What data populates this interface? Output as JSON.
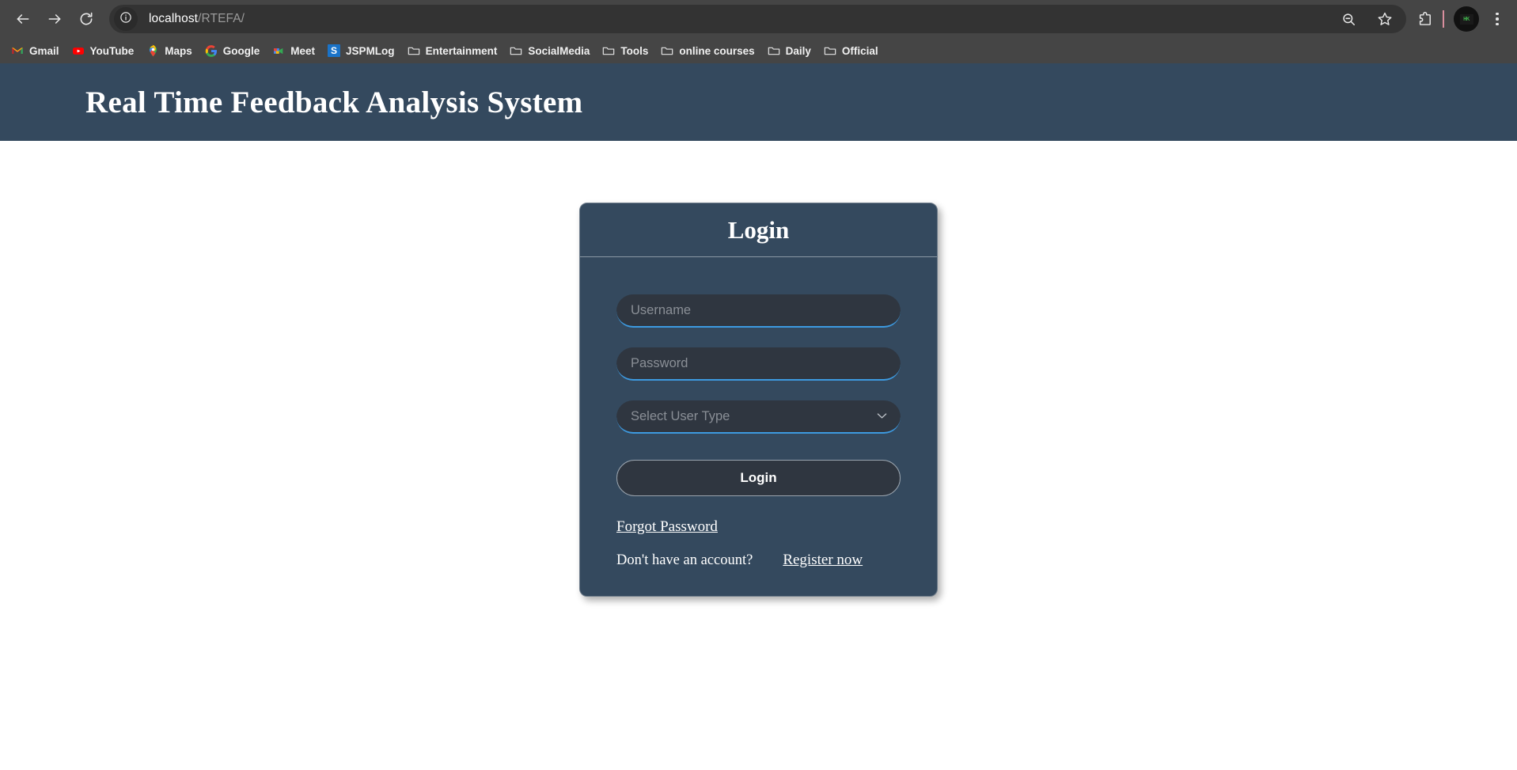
{
  "browser": {
    "back_icon": "back-arrow-icon",
    "forward_icon": "forward-arrow-icon",
    "reload_icon": "reload-icon",
    "site_info_icon": "info-circle-icon",
    "url_host": "localhost",
    "url_path": "/RTEFA/",
    "url_full": "localhost/RTEFA/",
    "zoom_icon": "search-zoom-icon",
    "bookmark_star_icon": "star-icon",
    "extensions_icon": "extensions-puzzle-icon",
    "avatar_label": "HK",
    "menu_icon": "three-dot-menu-icon",
    "bookmarks": [
      {
        "label": "Gmail",
        "icon": "gmail-icon"
      },
      {
        "label": "YouTube",
        "icon": "youtube-icon"
      },
      {
        "label": "Maps",
        "icon": "maps-pin-icon"
      },
      {
        "label": "Google",
        "icon": "google-g-icon"
      },
      {
        "label": "Meet",
        "icon": "google-meet-icon"
      },
      {
        "label": "JSPMLog",
        "icon": "jspmlog-icon"
      },
      {
        "label": "Entertainment",
        "icon": "folder-icon"
      },
      {
        "label": "SocialMedia",
        "icon": "folder-icon"
      },
      {
        "label": "Tools",
        "icon": "folder-icon"
      },
      {
        "label": "online courses",
        "icon": "folder-icon"
      },
      {
        "label": "Daily",
        "icon": "folder-icon"
      },
      {
        "label": "Official",
        "icon": "folder-icon"
      }
    ]
  },
  "app": {
    "header_title": "Real Time Feedback Analysis System",
    "header_bg": "#34495e"
  },
  "login": {
    "card_title": "Login",
    "username_placeholder": "Username",
    "username_value": "",
    "password_placeholder": "Password",
    "password_value": "",
    "usertype_selected": "Select User Type",
    "usertype_options": [
      "Select User Type"
    ],
    "usertype_chevron_icon": "chevron-down-icon",
    "submit_label": "Login",
    "forgot_password_label": "Forgot Password",
    "no_account_text": "Don't have an account?",
    "register_label": "Register now",
    "card_bg": "#34495e",
    "field_bg": "#2f3640",
    "field_underline": "#3d9ae0"
  }
}
